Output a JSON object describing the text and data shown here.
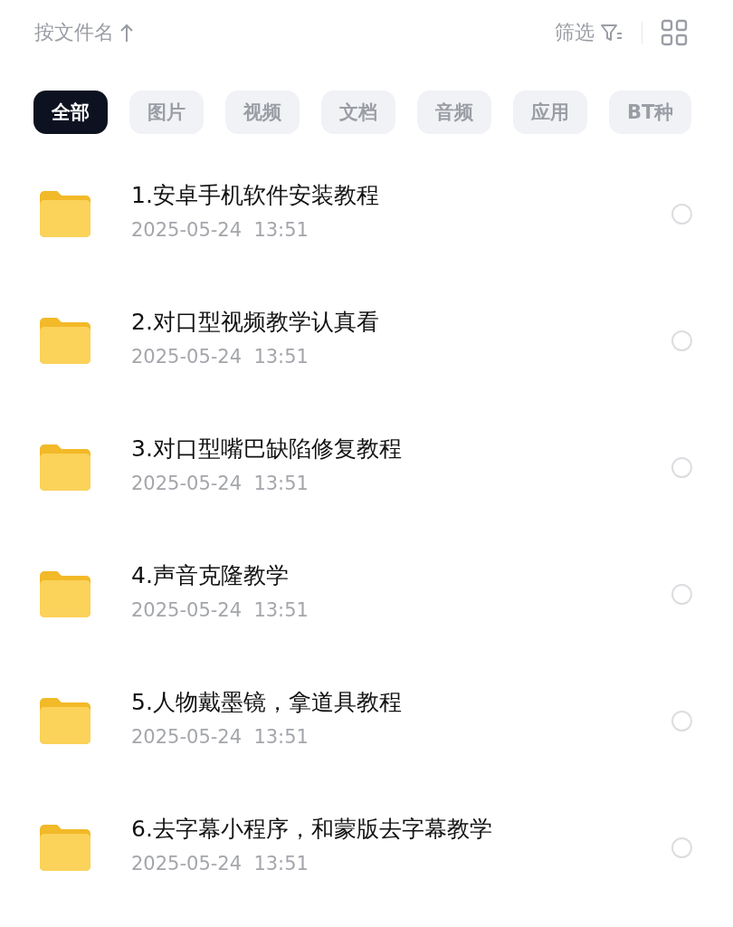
{
  "sort": {
    "label": "按文件名"
  },
  "filter": {
    "label": "筛选"
  },
  "tabs": [
    {
      "label": "全部",
      "selected": true
    },
    {
      "label": "图片",
      "selected": false
    },
    {
      "label": "视频",
      "selected": false
    },
    {
      "label": "文档",
      "selected": false
    },
    {
      "label": "音频",
      "selected": false
    },
    {
      "label": "应用",
      "selected": false
    },
    {
      "label": "BT种",
      "selected": false
    }
  ],
  "files": [
    {
      "name": "1.安卓手机软件安装教程",
      "date": "2025-05-24",
      "time": "13:51",
      "selected": false
    },
    {
      "name": "2.对口型视频教学认真看",
      "date": "2025-05-24",
      "time": "13:51",
      "selected": false
    },
    {
      "name": "3.对口型嘴巴缺陷修复教程",
      "date": "2025-05-24",
      "time": "13:51",
      "selected": false
    },
    {
      "name": "4.声音克隆教学",
      "date": "2025-05-24",
      "time": "13:51",
      "selected": false
    },
    {
      "name": "5.人物戴墨镜，拿道具教程",
      "date": "2025-05-24",
      "time": "13:51",
      "selected": false
    },
    {
      "name": "6.去字幕小程序，和蒙版去字幕教学",
      "date": "2025-05-24",
      "time": "13:51",
      "selected": false
    }
  ]
}
